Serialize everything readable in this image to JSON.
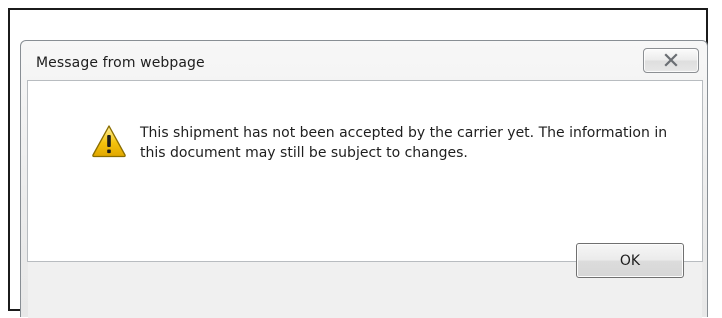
{
  "dialog": {
    "title": "Message from webpage",
    "message": "This shipment has not been accepted by the carrier yet. The information in this document may still be subject to changes.",
    "ok_label": "OK",
    "close_icon": "close-icon",
    "message_icon": "warning-icon"
  },
  "colors": {
    "warning_yellow": "#f4c20d",
    "warning_outline": "#8a6d00",
    "footer_gray": "#f0f0f0"
  }
}
